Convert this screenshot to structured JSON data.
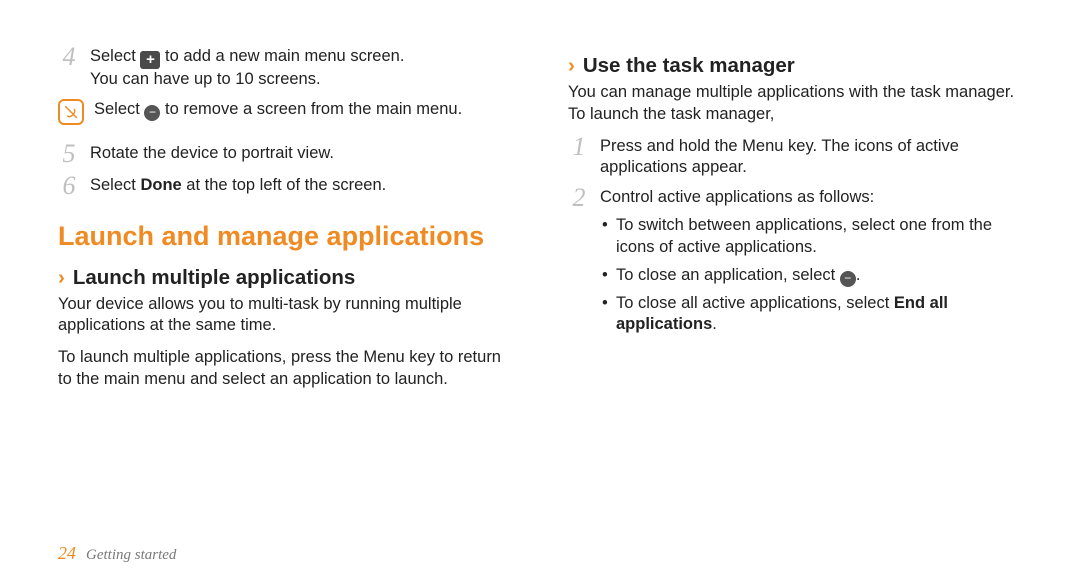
{
  "left": {
    "step4": {
      "num": "4",
      "line1_pre": "Select ",
      "line1_post": " to add a new main menu screen.",
      "line2": "You can have up to 10 screens."
    },
    "note": {
      "pre": "Select ",
      "post": " to remove a screen from the main menu."
    },
    "step5": {
      "num": "5",
      "text": "Rotate the device to portrait view."
    },
    "step6": {
      "num": "6",
      "pre": "Select ",
      "bold": "Done",
      "post": " at the top left of the screen."
    },
    "h1": "Launch and manage applications",
    "sub1": {
      "chev": "›",
      "title": "Launch multiple applications"
    },
    "p1": "Your device allows you to multi-task by running multiple applications at the same time.",
    "p2": "To launch multiple applications, press the Menu key to return to the main menu and select an application to launch."
  },
  "right": {
    "sub1": {
      "chev": "›",
      "title": "Use the task manager"
    },
    "p1": "You can manage multiple applications with the task manager. To launch the task manager,",
    "step1": {
      "num": "1",
      "text": "Press and hold the Menu key. The icons of active applications appear."
    },
    "step2": {
      "num": "2",
      "text": "Control active applications as follows:"
    },
    "b1": "To switch between applications, select one from the icons of active applications.",
    "b2_pre": "To close an application, select ",
    "b2_post": ".",
    "b3_pre": "To close all active applications, select ",
    "b3_bold": "End all applications",
    "b3_post": "."
  },
  "footer": {
    "page": "24",
    "section": "Getting started"
  }
}
